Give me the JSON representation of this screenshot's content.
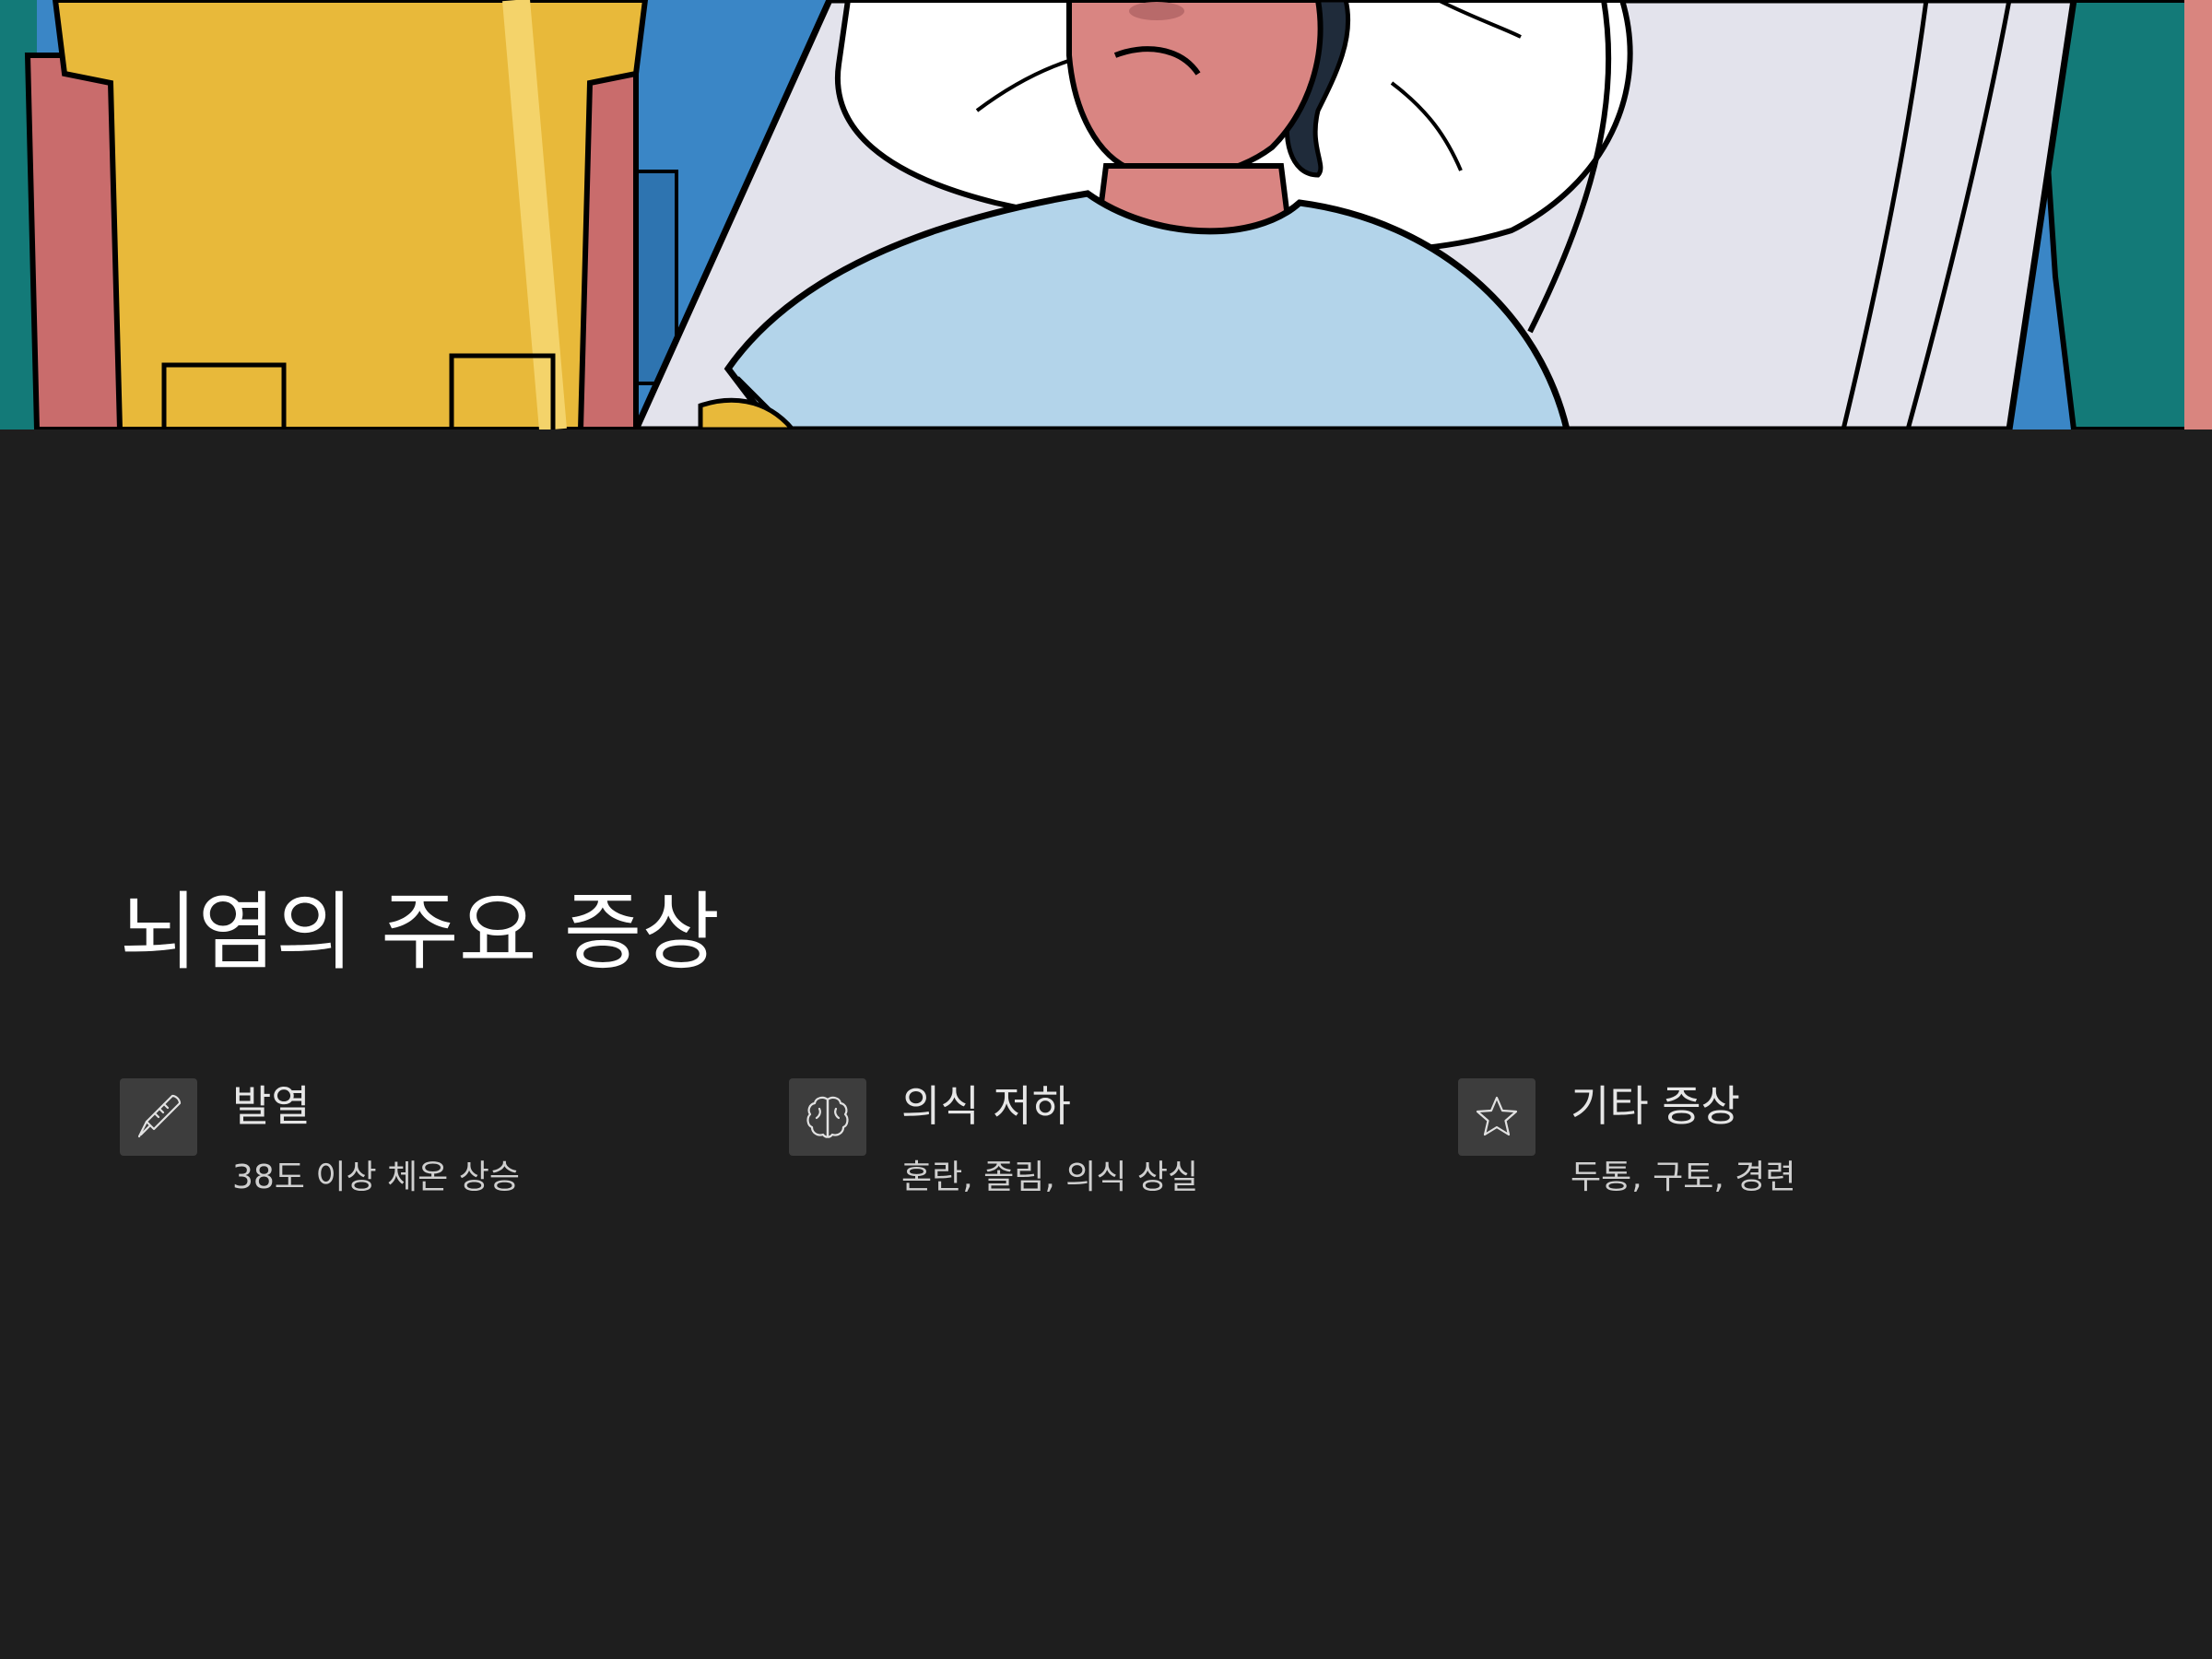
{
  "slide": {
    "title": "뇌염의 주요 증상",
    "background_color": "#1e1e1e",
    "hero_image": {
      "description_icon": "hospital-patient-illustration"
    },
    "symptoms": [
      {
        "icon": "thermometer-icon",
        "title": "발열",
        "description": "38도 이상 체온 상승"
      },
      {
        "icon": "brain-icon",
        "title": "의식 저하",
        "description": "혼란, 졸림, 의식 상실"
      },
      {
        "icon": "star-icon",
        "title": "기타 증상",
        "description": "두통, 구토, 경련"
      }
    ]
  }
}
